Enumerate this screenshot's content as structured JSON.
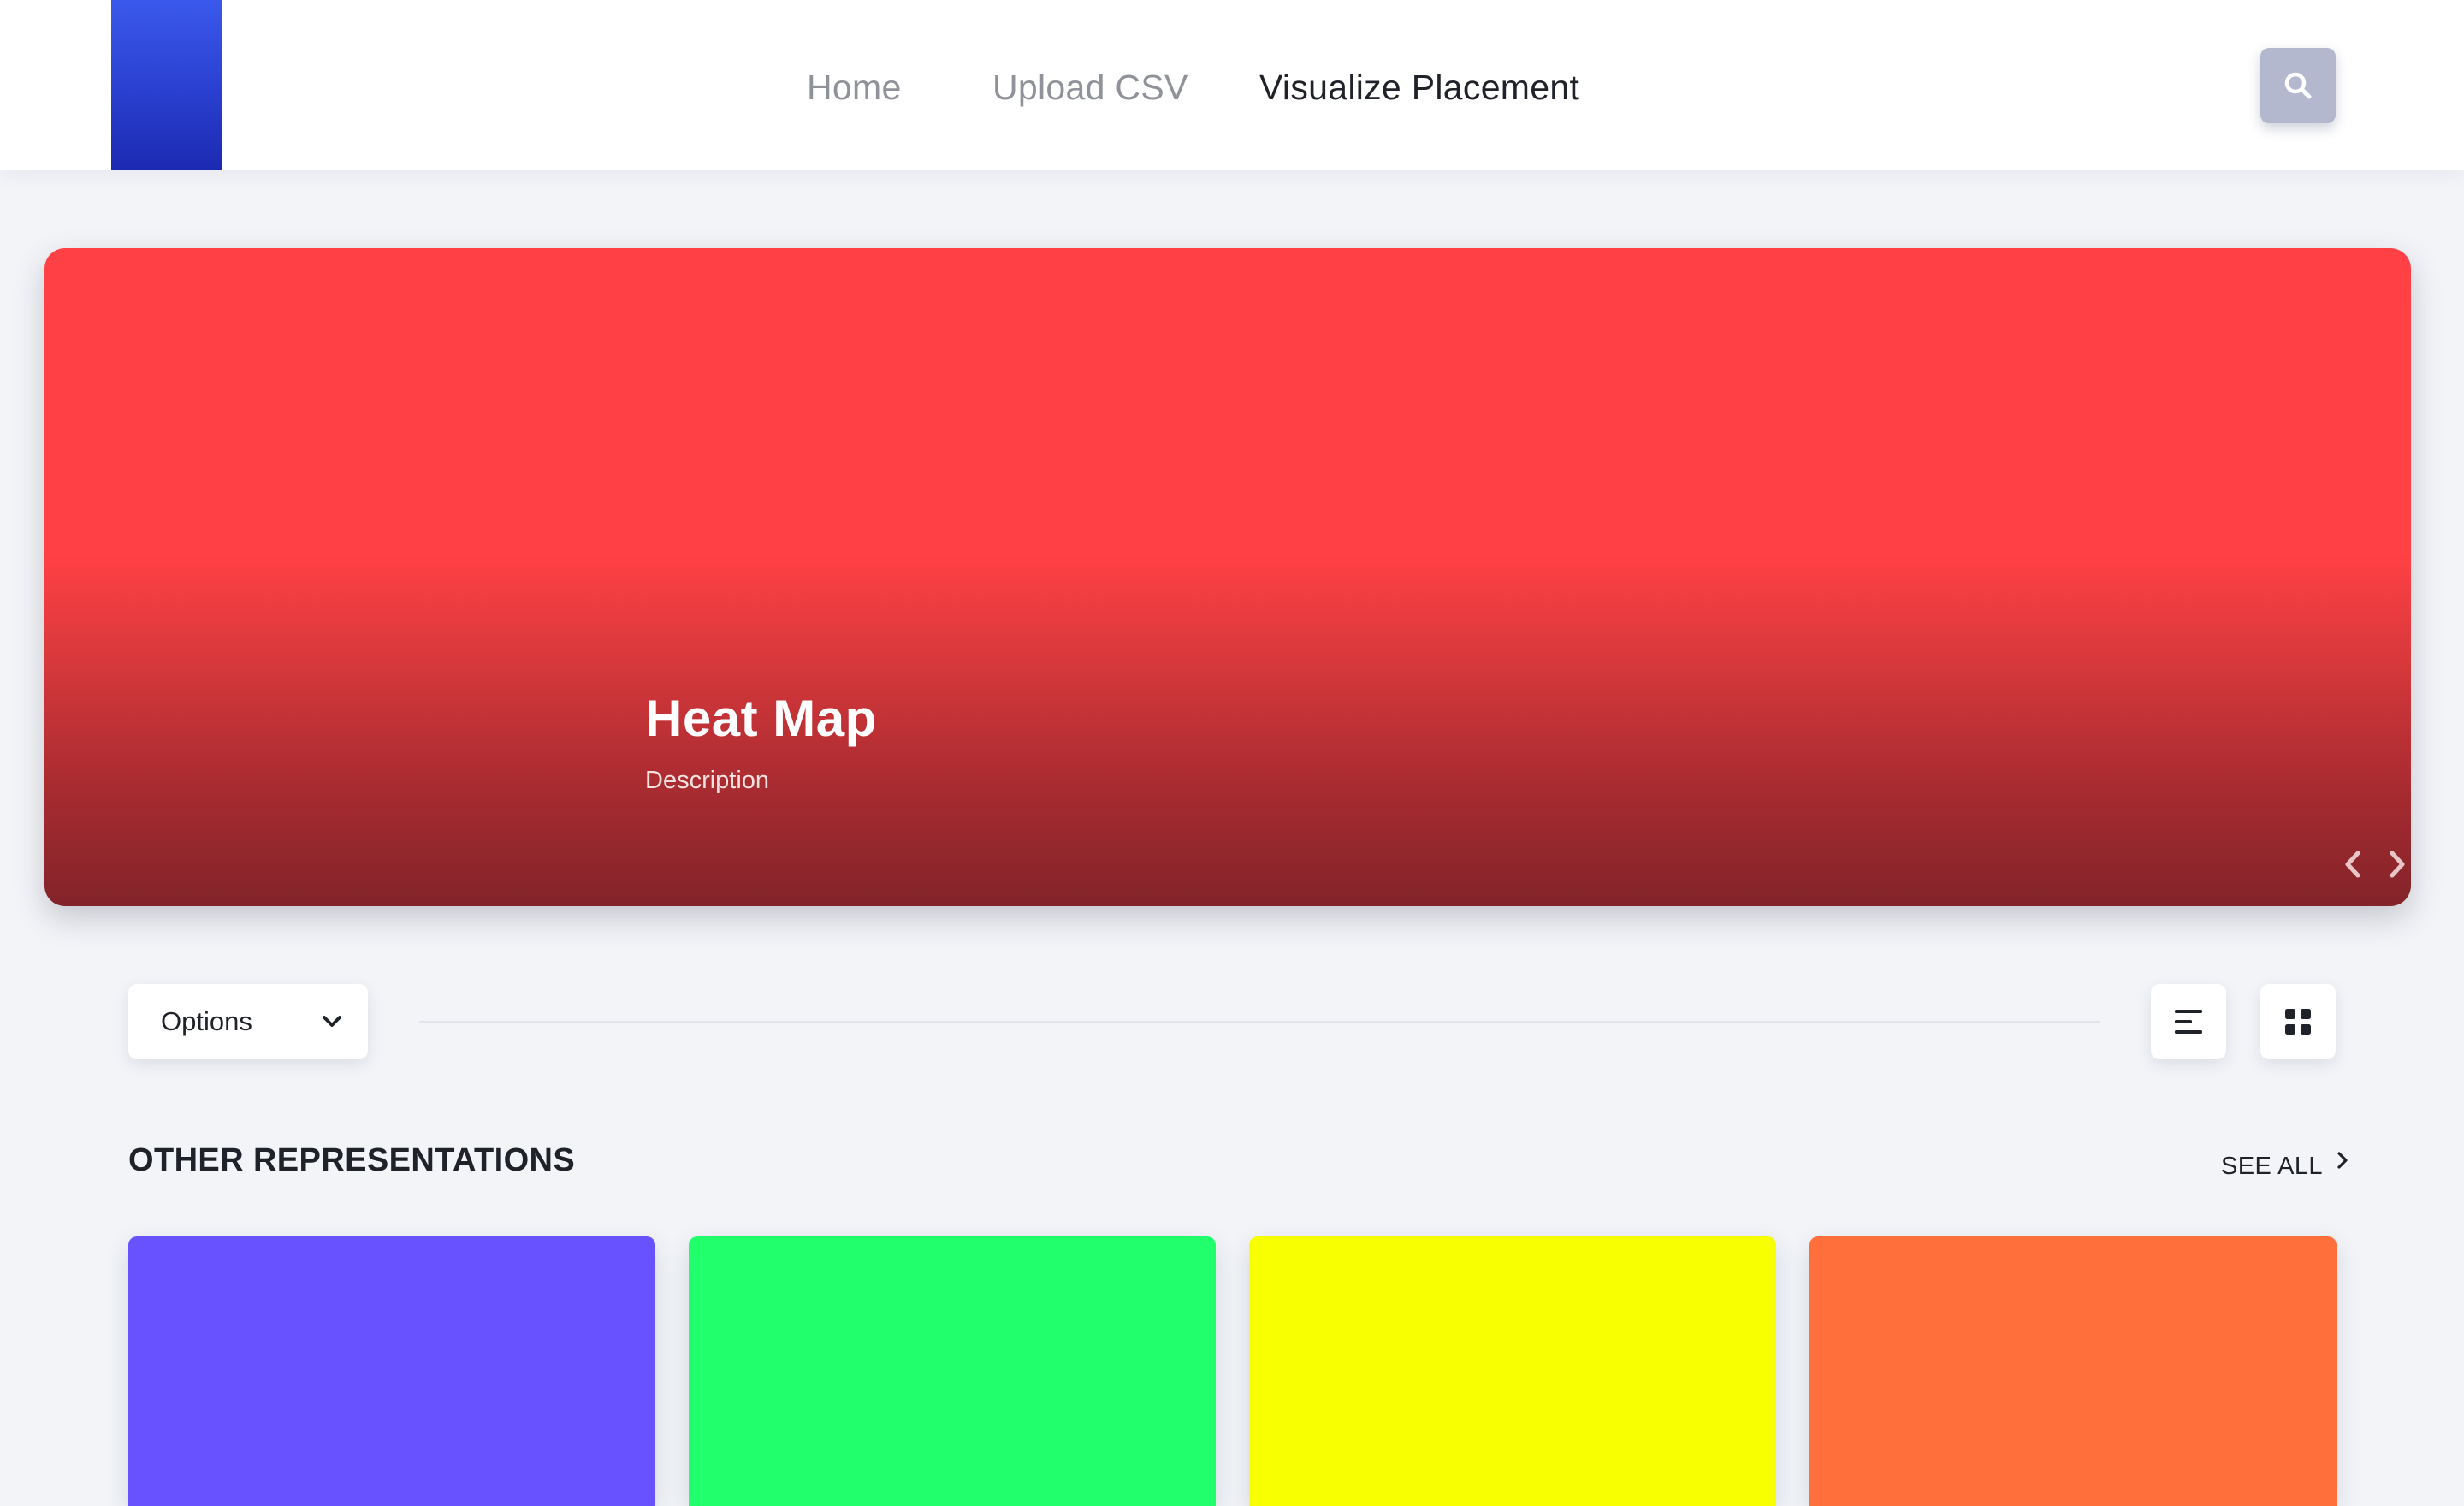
{
  "nav": {
    "items": [
      {
        "label": "Home"
      },
      {
        "label": "Upload CSV"
      },
      {
        "label": "Visualize Placement"
      }
    ],
    "active": "Visualize Placement"
  },
  "hero": {
    "title": "Heat Map",
    "description": "Description",
    "color": "#ff4044"
  },
  "toolbar": {
    "options_label": "Options"
  },
  "section": {
    "title": "OTHER REPRESENTATIONS",
    "see_all_label": "SEE ALL"
  },
  "cards": [
    {
      "color": "#6851ff"
    },
    {
      "color": "#22ff6c"
    },
    {
      "color": "#f7ff00"
    },
    {
      "color": "#ff6f3c"
    }
  ],
  "colors": {
    "logo": "#2a3fcf",
    "search_button": "#b3b8cf",
    "background": "#f2f4f8"
  },
  "icons": {
    "search": "search-icon",
    "prev": "chevron-left-icon",
    "next": "chevron-right-icon",
    "dropdown": "chevron-down-icon",
    "list_view": "list-view-icon",
    "grid_view": "grid-view-icon",
    "see_all": "chevron-right-icon"
  }
}
